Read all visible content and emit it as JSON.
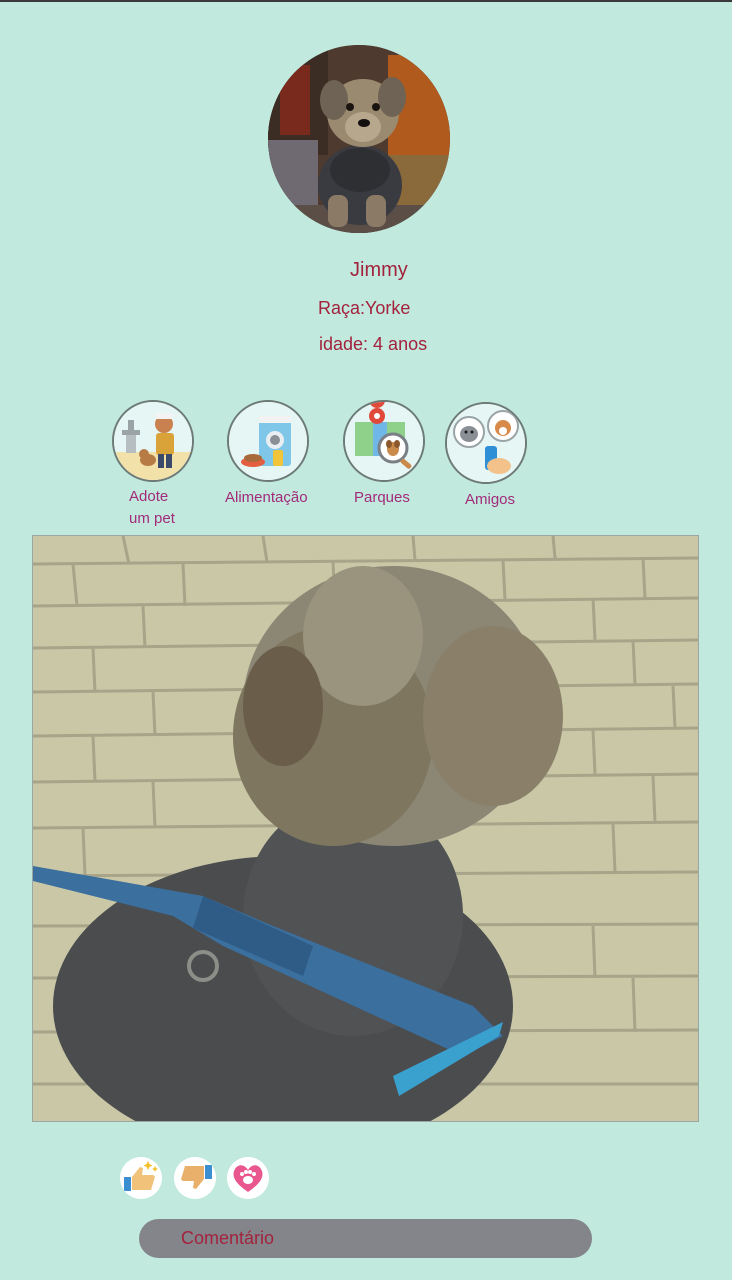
{
  "profile": {
    "name": "Jimmy",
    "breed": "Raça:Yorke",
    "age": "idade: 4 anos",
    "avatar_alt": "Yorkshire terrier sitting"
  },
  "categories": [
    {
      "label_line1": "Adote",
      "label_line2": "um pet",
      "icon": "adopt-pet-icon"
    },
    {
      "label": "Alimentação",
      "icon": "pet-food-icon"
    },
    {
      "label": "Parques",
      "icon": "park-map-icon"
    },
    {
      "label": "Amigos",
      "icon": "pet-friends-icon"
    }
  ],
  "post": {
    "photo_alt": "Yorkshire terrier with blue harness on paving stones"
  },
  "reactions": [
    {
      "icon": "like-icon"
    },
    {
      "icon": "dislike-icon"
    },
    {
      "icon": "heart-paw-icon"
    }
  ],
  "comment": {
    "placeholder": "Comentário"
  },
  "colors": {
    "background": "#c1e9de",
    "text_primary": "#a3223d",
    "text_category": "#a22b7a",
    "comment_bg": "#84858a"
  }
}
